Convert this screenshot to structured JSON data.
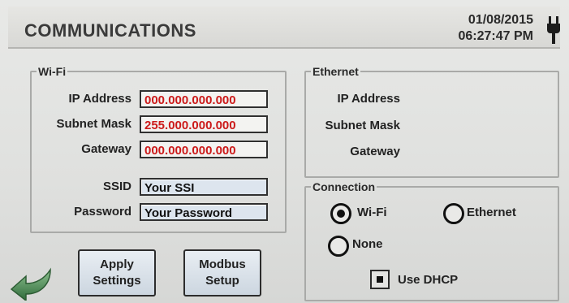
{
  "header": {
    "title": "COMMUNICATIONS",
    "date": "01/08/2015",
    "time": "06:27:47 PM",
    "power_icon": "plug-icon"
  },
  "wifi": {
    "legend": "Wi-Fi",
    "ip_label": "IP Address",
    "ip_value": "000.000.000.000",
    "subnet_label": "Subnet Mask",
    "subnet_value": "255.000.000.000",
    "gateway_label": "Gateway",
    "gateway_value": "000.000.000.000",
    "ssid_label": "SSID",
    "ssid_value": "Your SSI",
    "password_label": "Password",
    "password_value": "Your Password"
  },
  "ethernet": {
    "legend": "Ethernet",
    "ip_label": "IP Address",
    "subnet_label": "Subnet Mask",
    "gateway_label": "Gateway"
  },
  "connection": {
    "legend": "Connection",
    "wifi_label": "Wi-Fi",
    "ethernet_label": "Ethernet",
    "none_label": "None",
    "selected": "Wi-Fi",
    "dhcp_label": "Use DHCP",
    "dhcp_checked": true
  },
  "buttons": {
    "apply_line1": "Apply",
    "apply_line2": "Settings",
    "modbus_line1": "Modbus",
    "modbus_line2": "Setup",
    "back_icon": "back-arrow-icon"
  },
  "colors": {
    "ip_text": "#cc1a1a",
    "field_blue": "#dde5ee",
    "arrow_green": "#3f7f4a"
  }
}
